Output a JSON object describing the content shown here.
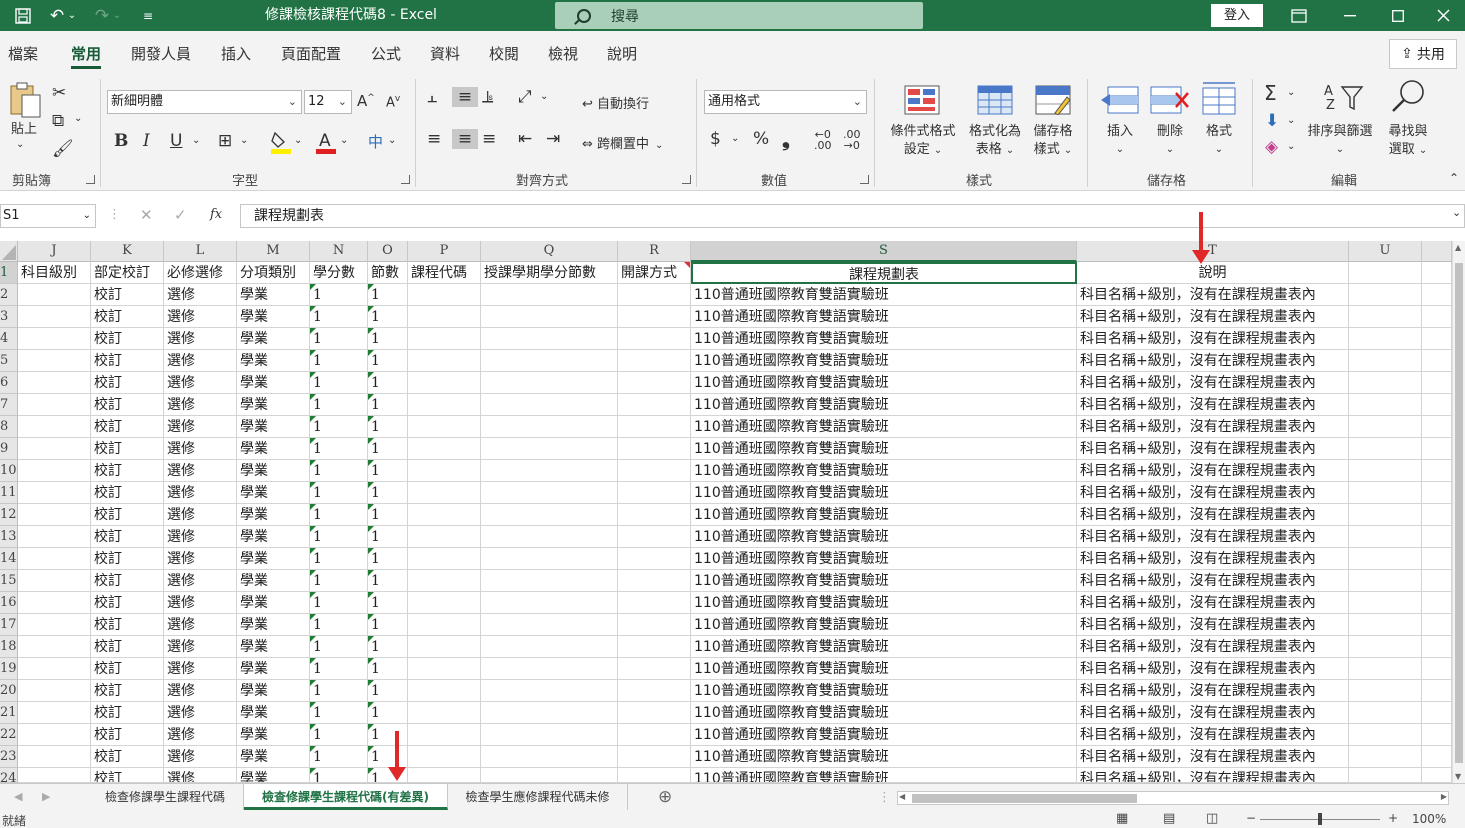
{
  "titlebar": {
    "title": "修課檢核課程代碼8  -  Excel",
    "search_placeholder": "搜尋",
    "login_label": "登入",
    "icons": [
      "save-icon",
      "undo-icon",
      "redo-icon",
      "customize-icon",
      "ribbon-display-icon",
      "minimize-icon",
      "maximize-icon",
      "close-icon"
    ]
  },
  "ribbon_tabs": [
    "檔案",
    "常用",
    "開發人員",
    "插入",
    "頁面配置",
    "公式",
    "資料",
    "校閱",
    "檢視",
    "說明"
  ],
  "active_tab": "常用",
  "share_label": "共用",
  "clipboard": {
    "paste": "貼上",
    "group": "剪貼簿"
  },
  "font": {
    "name": "新細明體",
    "size": "12",
    "group": "字型",
    "bold": "B",
    "italic": "I",
    "underline": "U"
  },
  "alignment": {
    "wrap": "自動換行",
    "merge": "跨欄置中",
    "group": "對齊方式"
  },
  "number": {
    "format": "通用格式",
    "group": "數值",
    "currency": "$",
    "percent": "%",
    "comma": "❟"
  },
  "styles": {
    "conditional": [
      "條件式格式",
      "設定"
    ],
    "as_table": [
      "格式化為",
      "表格"
    ],
    "cell_styles": [
      "儲存格",
      "樣式"
    ],
    "group": "樣式"
  },
  "cells": {
    "insert": "插入",
    "delete": "刪除",
    "format": "格式",
    "group": "儲存格"
  },
  "editing": {
    "sort": "排序與篩選",
    "find": [
      "尋找與",
      "選取"
    ],
    "group": "編輯"
  },
  "formula_bar": {
    "name_box": "S1",
    "content": "課程規劃表",
    "fx": "fx"
  },
  "columns": [
    "J",
    "K",
    "L",
    "M",
    "N",
    "O",
    "P",
    "Q",
    "R",
    "S",
    "T",
    "U"
  ],
  "header_row": [
    "科目級別",
    "部定校訂",
    "必修選修",
    "分項類別",
    "學分數",
    "節數",
    "課程代碼",
    "授課學期學分節數",
    "開課方式",
    "課程規劃表",
    "說明",
    ""
  ],
  "row_template": {
    "J": "",
    "K": "校訂",
    "L": "選修",
    "M": "學業",
    "N": "1",
    "O": "1",
    "P": "",
    "Q": "",
    "R": "",
    "S": "110普通班國際教育雙語實驗班",
    "T": "科目名稱+級別，沒有在課程規畫表內"
  },
  "row_numbers": [
    "1",
    "2",
    "3",
    "4",
    "5",
    "6",
    "7",
    "8",
    "9",
    "10",
    "11",
    "12",
    "13",
    "14",
    "15",
    "16",
    "17",
    "18",
    "19",
    "20",
    "21",
    "22",
    "23",
    "24"
  ],
  "sheet_tabs": [
    "檢查修課學生課程代碼",
    "檢查修課學生課程代碼(有差異)",
    "檢查學生應修課程代碼未修"
  ],
  "active_sheet": "檢查修課學生課程代碼(有差異)",
  "status": {
    "ready": "就緒",
    "zoom": "100%"
  }
}
